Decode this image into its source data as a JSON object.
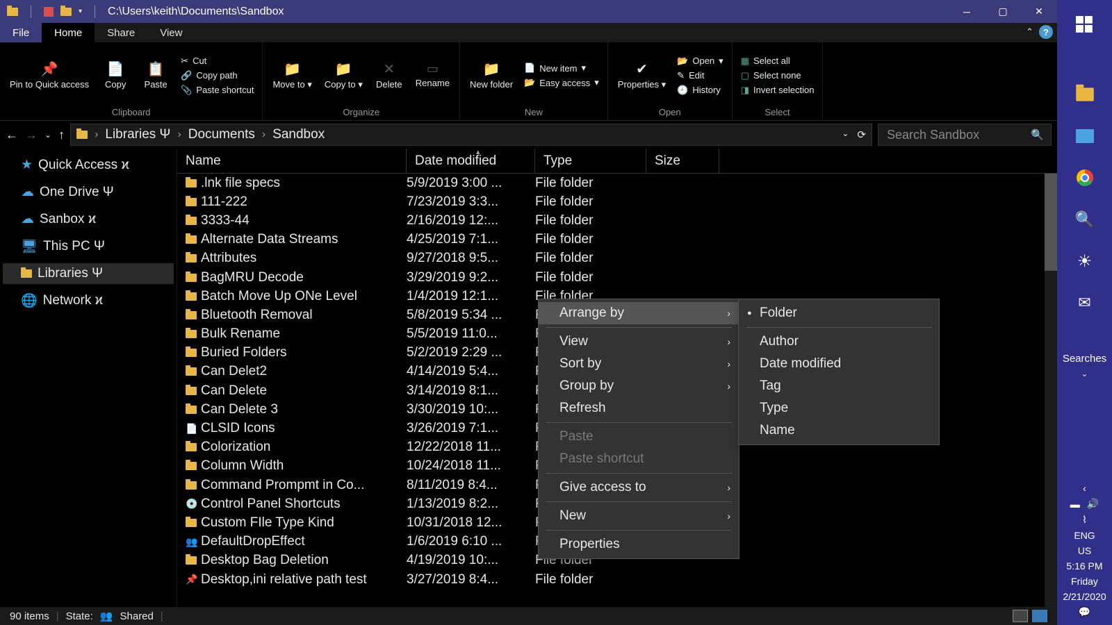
{
  "title_path": "C:\\Users\\keith\\Documents\\Sandbox",
  "tabs": {
    "file": "File",
    "home": "Home",
    "share": "Share",
    "view": "View"
  },
  "ribbon": {
    "pin": "Pin to Quick access",
    "copy": "Copy",
    "paste": "Paste",
    "cut": "Cut",
    "copypath": "Copy path",
    "pasteshortcut": "Paste shortcut",
    "g1": "Clipboard",
    "moveto": "Move to",
    "copyto": "Copy to",
    "delete": "Delete",
    "rename": "Rename",
    "g2": "Organize",
    "newfolder": "New folder",
    "newitem": "New item",
    "easyaccess": "Easy access",
    "g3": "New",
    "properties": "Properties",
    "open": "Open",
    "edit": "Edit",
    "history": "History",
    "g4": "Open",
    "selectall": "Select all",
    "selectnone": "Select none",
    "invert": "Invert selection",
    "g5": "Select"
  },
  "breadcrumb": {
    "libraries": "Libraries Ψ",
    "documents": "Documents",
    "sandbox": "Sandbox"
  },
  "search_placeholder": "Search Sandbox",
  "tree": {
    "quick": "Quick Access ϰ",
    "onedrive": "One Drive Ψ",
    "sanbox": "Sanbox ϰ",
    "thispc": "This PC Ψ",
    "libraries": "Libraries Ψ",
    "network": "Network ϰ"
  },
  "cols": {
    "name": "Name",
    "date": "Date modified",
    "type": "Type",
    "size": "Size"
  },
  "rows": [
    {
      "n": ".lnk file specs",
      "d": "5/9/2019 3:00 ...",
      "t": "File folder",
      "ic": "f"
    },
    {
      "n": "111-222",
      "d": "7/23/2019 3:3...",
      "t": "File folder",
      "ic": "f"
    },
    {
      "n": "3333-44",
      "d": "2/16/2019 12:...",
      "t": "File folder",
      "ic": "f"
    },
    {
      "n": "Alternate Data Streams",
      "d": "4/25/2019 7:1...",
      "t": "File folder",
      "ic": "f"
    },
    {
      "n": "Attributes",
      "d": "9/27/2018 9:5...",
      "t": "File folder",
      "ic": "f"
    },
    {
      "n": "BagMRU Decode",
      "d": "3/29/2019 9:2...",
      "t": "File folder",
      "ic": "f"
    },
    {
      "n": "Batch Move Up ONe Level",
      "d": "1/4/2019 12:1...",
      "t": "File folder",
      "ic": "f"
    },
    {
      "n": "Bluetooth Removal",
      "d": "5/8/2019 5:34 ...",
      "t": "File folder",
      "ic": "f"
    },
    {
      "n": "Bulk Rename",
      "d": "5/5/2019 11:0...",
      "t": "File folder",
      "ic": "f"
    },
    {
      "n": "Buried  Folders",
      "d": "5/2/2019 2:29 ...",
      "t": "File folder",
      "ic": "f"
    },
    {
      "n": "Can Delet2",
      "d": "4/14/2019 5:4...",
      "t": "File folder",
      "ic": "f"
    },
    {
      "n": "Can Delete",
      "d": "3/14/2019 8:1...",
      "t": "File folder",
      "ic": "f"
    },
    {
      "n": "Can Delete 3",
      "d": "3/30/2019 10:...",
      "t": "File folder",
      "ic": "f"
    },
    {
      "n": "CLSID Icons",
      "d": "3/26/2019 7:1...",
      "t": "File folder",
      "ic": "d"
    },
    {
      "n": "Colorization",
      "d": "12/22/2018 11...",
      "t": "File folder",
      "ic": "f"
    },
    {
      "n": "Column Width",
      "d": "10/24/2018 11...",
      "t": "File folder",
      "ic": "f"
    },
    {
      "n": "Command Prompmt in Co...",
      "d": "8/11/2019 8:4...",
      "t": "File folder",
      "ic": "f"
    },
    {
      "n": "Control Panel Shortcuts",
      "d": "1/13/2019 8:2...",
      "t": "File folder",
      "ic": "c"
    },
    {
      "n": "Custom FIle Type Kind",
      "d": "10/31/2018 12...",
      "t": "File folder",
      "ic": "f"
    },
    {
      "n": "DefaultDropEffect",
      "d": "1/6/2019 6:10 ...",
      "t": "File folder",
      "ic": "p"
    },
    {
      "n": "Desktop Bag Deletion",
      "d": "4/19/2019 10:...",
      "t": "File folder",
      "ic": "f"
    },
    {
      "n": "Desktop,ini relative path test",
      "d": "3/27/2019 8:4...",
      "t": "File folder",
      "ic": "b"
    }
  ],
  "ctx1": {
    "arrange": "Arrange by",
    "view": "View",
    "sort": "Sort by",
    "group": "Group by",
    "refresh": "Refresh",
    "paste": "Paste",
    "pasteshortcut": "Paste shortcut",
    "giveaccess": "Give access to",
    "new": "New",
    "properties": "Properties"
  },
  "ctx2": {
    "folder": "Folder",
    "author": "Author",
    "datemod": "Date modified",
    "tag": "Tag",
    "type": "Type",
    "name": "Name"
  },
  "status": {
    "items": "90 items",
    "state": "State:",
    "shared": "Shared"
  },
  "taskbar": {
    "searches": "Searches",
    "lang1": "ENG",
    "lang2": "US",
    "time": "5:16 PM",
    "day": "Friday",
    "date": "2/21/2020"
  }
}
